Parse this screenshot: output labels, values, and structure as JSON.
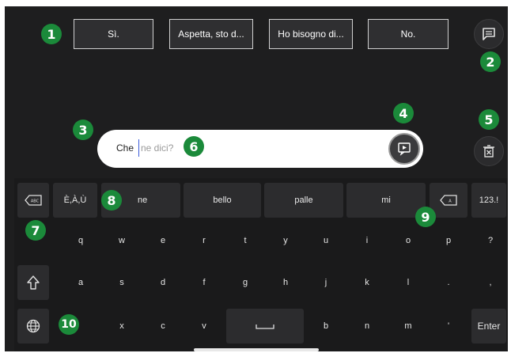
{
  "phrases": [
    "Sì.",
    "Aspetta, sto d...",
    "Ho bisogno di...",
    "No."
  ],
  "text_field": {
    "typed": "Che ",
    "suggestion": "ne dici?"
  },
  "suggestions": [
    "ne",
    "bello",
    "palle",
    "mi"
  ],
  "keys": {
    "accents": "È,À,Ù",
    "numbers": "123.!",
    "enter": "Enter",
    "row1": [
      "q",
      "w",
      "e",
      "r",
      "t",
      "y",
      "u",
      "i",
      "o",
      "p",
      "?"
    ],
    "row2": [
      "a",
      "s",
      "d",
      "f",
      "g",
      "h",
      "j",
      "k",
      "l",
      ".",
      ","
    ],
    "row3": [
      "x",
      "c",
      "v",
      "b",
      "n",
      "m",
      "'"
    ]
  },
  "badges": [
    "1",
    "2",
    "3",
    "4",
    "5",
    "6",
    "7",
    "8",
    "9",
    "10"
  ],
  "colors": {
    "background": "#1e1e1f",
    "key": "#2c2c2e",
    "badge": "#1b8a3a",
    "caret": "#3a5bd9"
  },
  "icons": [
    "chat-icon",
    "speak-icon",
    "clear-icon",
    "backspace-word-icon",
    "backspace-icon",
    "shift-icon",
    "globe-icon",
    "space-icon"
  ]
}
